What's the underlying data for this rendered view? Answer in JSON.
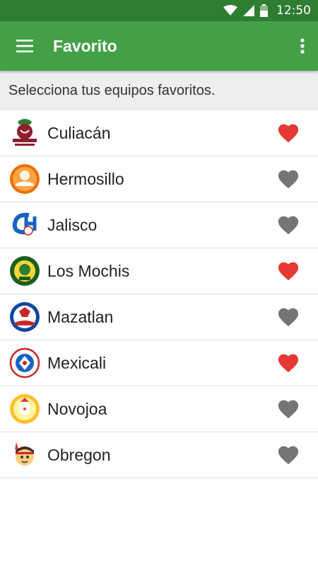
{
  "status_bar": {
    "time": "12:50",
    "icons": [
      "wifi-icon",
      "signal-icon",
      "battery-icon"
    ]
  },
  "app_bar": {
    "title": "Favorito",
    "menu_icon": "hamburger-menu-icon",
    "overflow_icon": "more-vertical-icon",
    "background_color": "#43a047",
    "status_color": "#2e7d32"
  },
  "subtitle": "Selecciona tus equipos favoritos.",
  "colors": {
    "favorite_on": "#e53935",
    "favorite_off": "#757575"
  },
  "teams": [
    {
      "name": "Culiacán",
      "logo_icon": "culiacan-logo-icon",
      "favorite": true
    },
    {
      "name": "Hermosillo",
      "logo_icon": "hermosillo-logo-icon",
      "favorite": false
    },
    {
      "name": "Jalisco",
      "logo_icon": "jalisco-logo-icon",
      "favorite": false
    },
    {
      "name": "Los Mochis",
      "logo_icon": "los-mochis-logo-icon",
      "favorite": true
    },
    {
      "name": "Mazatlan",
      "logo_icon": "mazatlan-logo-icon",
      "favorite": false
    },
    {
      "name": "Mexicali",
      "logo_icon": "mexicali-logo-icon",
      "favorite": true
    },
    {
      "name": "Novojoa",
      "logo_icon": "novojoa-logo-icon",
      "favorite": false
    },
    {
      "name": "Obregon",
      "logo_icon": "obregon-logo-icon",
      "favorite": false
    }
  ]
}
